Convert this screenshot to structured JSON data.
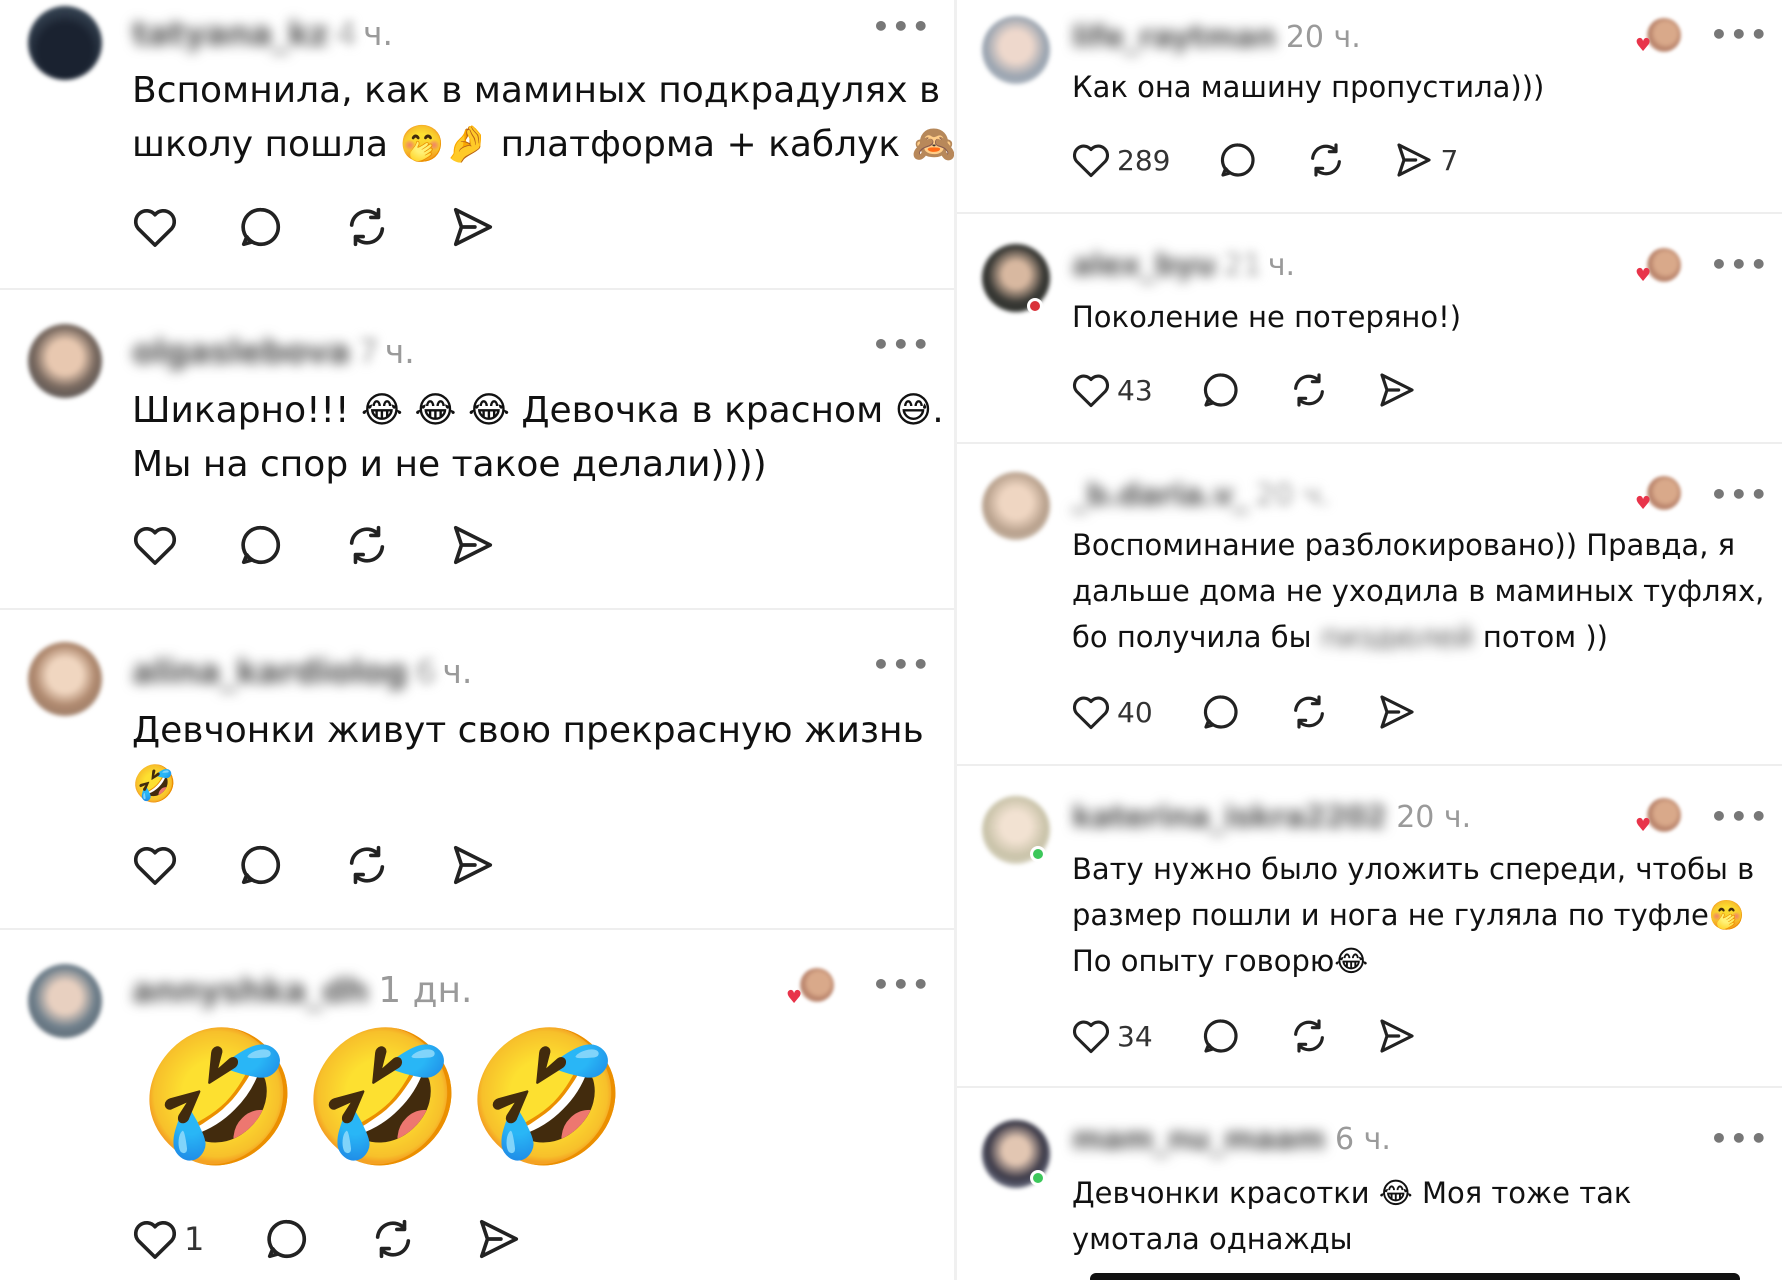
{
  "left_posts": [
    {
      "username": "tatyana_kz",
      "time_blur": "4",
      "time": "ч.",
      "text_lines": [
        "Вспомнила, как в маминых подкрадулях в",
        "школу пошла 🤭🤌 платформа + каблук 🙈"
      ],
      "more": "•••"
    },
    {
      "username": "olgaslebova",
      "time_blur": "7",
      "time": "ч.",
      "text_lines": [
        "Шикарно!!! 😂 😂 😂 Девочка в красном 😅.",
        "Мы на спор и не такое делали))))"
      ],
      "more": "•••"
    },
    {
      "username": "alina_kardiolog",
      "time_blur": "6",
      "time": "ч.",
      "text_lines": [
        "Девчонки живут свою прекрасную жизнь",
        "🤣"
      ],
      "more": "•••"
    },
    {
      "username": "annyshka_dh",
      "time": "1 дн.",
      "emojis": [
        "🤣",
        "🤣",
        "🤣"
      ],
      "like_count": "1",
      "more": "•••"
    }
  ],
  "right_posts": [
    {
      "username": "life_raytman",
      "time": "20 ч.",
      "text_lines": [
        "Как она машину пропустила)))"
      ],
      "like_count": "289",
      "share_count": "7",
      "more": "•••"
    },
    {
      "username": "alex_byu",
      "time_blur": "21",
      "time": "ч.",
      "text_lines": [
        "Поколение не потеряно!)"
      ],
      "like_count": "43",
      "more": "•••"
    },
    {
      "username": "_b.daria.v_",
      "time_blur": "20 ч.",
      "text_lines": [
        "Воспоминание разблокировано)) Правда, я",
        "дальше дома не уходила в маминых туфлях,"
      ],
      "line3_before": "бо получила бы",
      "line3_blur": "пиздюлей",
      "line3_after": "потом ))",
      "like_count": "40",
      "more": "•••"
    },
    {
      "username": "katerina_iskra2202",
      "time": "20 ч.",
      "text_lines": [
        "Вату нужно было уложить спереди, чтобы в",
        "размер пошли и нога не гуляла по туфле🤭",
        "По опыту говорю😂"
      ],
      "like_count": "34",
      "more": "•••"
    },
    {
      "username": "mam_nu_maam",
      "time": "6 ч.",
      "text_lines": [
        "Девчонки красотки 😂 Моя тоже так",
        "умотала однажды"
      ],
      "more": "•••"
    }
  ],
  "icons": {
    "like": "heart-icon",
    "reply": "comment-icon",
    "repost": "repost-icon",
    "share": "send-icon",
    "more": "more-icon"
  }
}
